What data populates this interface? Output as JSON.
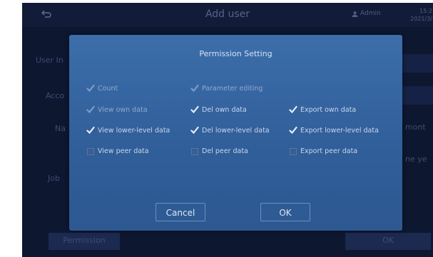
{
  "header": {
    "back_icon": "back-arrow-icon",
    "title": "Add user",
    "user": "Admin",
    "time_line1": "15:2",
    "time_line2": "2021/3/"
  },
  "background": {
    "user_info_label": "User In",
    "account_label": "Acco",
    "name_label": "Na",
    "job_label": "Job",
    "right_text_1": "mont",
    "right_text_2": "ne ye",
    "permission_button": "Permission",
    "ok_button": "OK"
  },
  "dialog": {
    "title": "Permission Setting",
    "permissions": [
      {
        "label": "Count",
        "checked": true,
        "disabled": true
      },
      {
        "label": "Parameter editing",
        "checked": true,
        "disabled": true
      },
      {
        "label": "View own data",
        "checked": true,
        "disabled": true
      },
      {
        "label": "Del own data",
        "checked": true,
        "disabled": false
      },
      {
        "label": "Export own data",
        "checked": true,
        "disabled": false
      },
      {
        "label": "View lower-level data",
        "checked": true,
        "disabled": false
      },
      {
        "label": "Del lower-level data",
        "checked": true,
        "disabled": false
      },
      {
        "label": "Export lower-level data",
        "checked": true,
        "disabled": false
      },
      {
        "label": "View peer data",
        "checked": false,
        "disabled": false
      },
      {
        "label": "Del peer data",
        "checked": false,
        "disabled": false
      },
      {
        "label": "Export peer data",
        "checked": false,
        "disabled": false
      }
    ],
    "cancel_label": "Cancel",
    "ok_label": "OK"
  },
  "colors": {
    "screen_bg": "#0d1730",
    "dialog_bg": "#3c6eaa",
    "check_enabled": "#e6eefa",
    "check_disabled": "#7f9cc6"
  }
}
